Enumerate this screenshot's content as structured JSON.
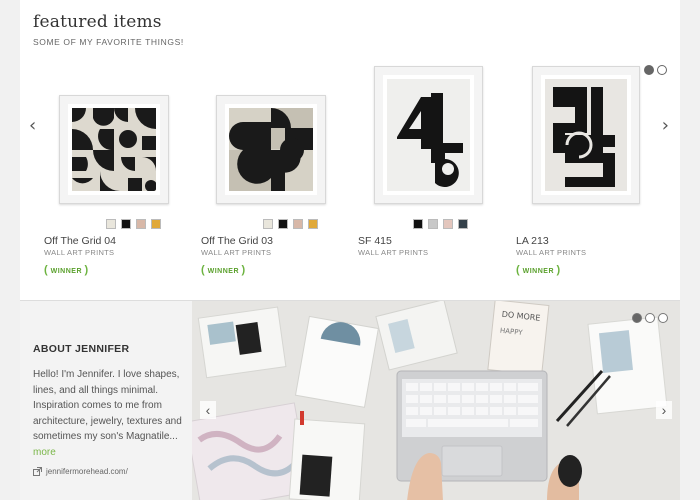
{
  "featured": {
    "title": "featured items",
    "subtitle": "SOME OF MY FAVORITE THINGS!",
    "prev_arrow": "‹",
    "next_arrow": "›",
    "products": [
      {
        "name": "Off The Grid 04",
        "type": "WALL ART PRINTS",
        "badge": "WINNER",
        "swatches": [
          "#e9e6dc",
          "#111111",
          "#d8b8a8",
          "#e0a93a"
        ]
      },
      {
        "name": "Off The Grid 03",
        "type": "WALL ART PRINTS",
        "badge": "WINNER",
        "swatches": [
          "#e9e6dc",
          "#111111",
          "#d8b8a8",
          "#e0a93a"
        ]
      },
      {
        "name": "SF 415",
        "type": "WALL ART PRINTS",
        "badge": "",
        "swatches": [
          "#111111",
          "#c8c8c8",
          "#e3c6bd",
          "#34414a"
        ]
      },
      {
        "name": "LA 213",
        "type": "WALL ART PRINTS",
        "badge": "WINNER",
        "swatches": []
      }
    ]
  },
  "about": {
    "title": "ABOUT JENNIFER",
    "text": "Hello! I'm Jennifer. I love shapes, lines, and all things minimal. Inspiration comes to me from architecture, jewelry, textures and sometimes my son's Magnatile...",
    "more": "more",
    "link": "jennifermorehead.com/",
    "prev_arrow": "‹",
    "next_arrow": "›"
  },
  "colors": {
    "accent_green": "#7ab648",
    "text_dark": "#333333",
    "panel_bg": "#f3f3f3"
  },
  "icons": [
    "chevron-left-icon",
    "chevron-right-icon",
    "external-link-icon",
    "laurel-icon",
    "carousel-dot-icon"
  ]
}
